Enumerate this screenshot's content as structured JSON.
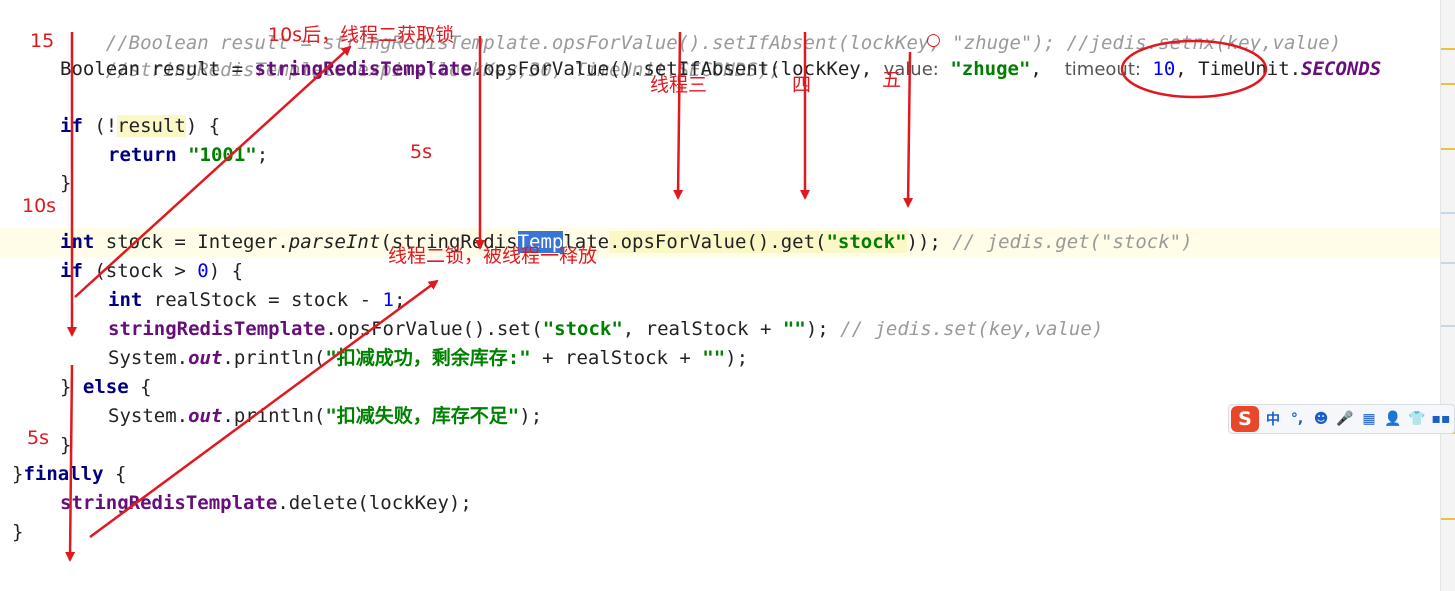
{
  "code": {
    "l1_comment": "//Boolean result = stringRedisTemplate.opsForValue().setIfAbsent(lockKey, \"zhuge\"); //jedis.setnx(key,value)",
    "l2_comment": "//stringRedisTemplate.expire(lockKey,30, TimeUnit.SECONDS);",
    "l3_a": "Boolean result = ",
    "l3_tpl": "stringRedisTemplate",
    "l3_b": ".opsForValue().setIfAbsent(lockKey, ",
    "l3_hint_value": "value:",
    "l3_str": "\"zhuge\"",
    "l3_comma": ", ",
    "l3_hint_timeout": "timeout:",
    "l3_num": "10",
    "l3_c": ", TimeUnit.",
    "l3_seconds": "SECONDS",
    "l5_if": "if",
    "l5_a": " (!",
    "l5_result": "result",
    "l5_b": ") {",
    "l6_return": "return",
    "l6_str": "\"1001\"",
    "l6_end": ";",
    "l7": "}",
    "l9_int": "int",
    "l9_a": " stock = Integer.",
    "l9_parse": "parseInt",
    "l9_b": "(stringRedis",
    "l9_sel": "Temp",
    "l9_c": "late",
    "l9_d": ".opsForValue().get(",
    "l9_str": "\"stock\"",
    "l9_e": "));",
    "l9_cmt": "// jedis.get(\"stock\")",
    "l10_if": "if",
    "l10_a": " (stock > ",
    "l10_num": "0",
    "l10_b": ") {",
    "l11_int": "int",
    "l11_a": " realStock = stock - ",
    "l11_num": "1",
    "l11_b": ";",
    "l12_tpl": "stringRedisTemplate",
    "l12_a": ".opsForValue().set(",
    "l12_str": "\"stock\"",
    "l12_b": ", realStock + ",
    "l12_str2": "\"\"",
    "l12_c": ");",
    "l12_cmt": "// jedis.set(key,value)",
    "l13_a": "System.",
    "l13_out": "out",
    "l13_b": ".println(",
    "l13_str": "\"扣减成功，剩余库存:\"",
    "l13_c": " + realStock + ",
    "l13_str2": "\"\"",
    "l13_d": ");",
    "l14_a": "} ",
    "l14_else": "else",
    "l14_b": " {",
    "l15_a": "System.",
    "l15_out": "out",
    "l15_b": ".println(",
    "l15_str": "\"扣减失败，库存不足\"",
    "l15_c": ");",
    "l16": "}",
    "l17_a": "}",
    "l17_finally": "finally",
    "l17_b": " {",
    "l18_tpl": "stringRedisTemplate",
    "l18_a": ".delete(lockKey);",
    "l19": "}"
  },
  "annotations": {
    "n15": "15",
    "n10s": "10s",
    "n5s_left": "5s",
    "n10s_after": "10s后，线程二获取锁",
    "n5s_mid": "5s",
    "thread3": "线程三",
    "thread4": "四",
    "thread5": "五",
    "circle_dot": "○",
    "thread2_release": "线程二锁，被线程一释放"
  },
  "ime": {
    "logo": "S",
    "cn": "中",
    "punct": "°,",
    "emoji": "☻",
    "mic": "🎤",
    "keyboard": "▦",
    "user": "👤",
    "shirt": "👕",
    "grid": "▪▪"
  },
  "colors": {
    "annotation": "#e0191f",
    "keyword": "#000080",
    "string": "#008000",
    "field": "#660e7a"
  }
}
